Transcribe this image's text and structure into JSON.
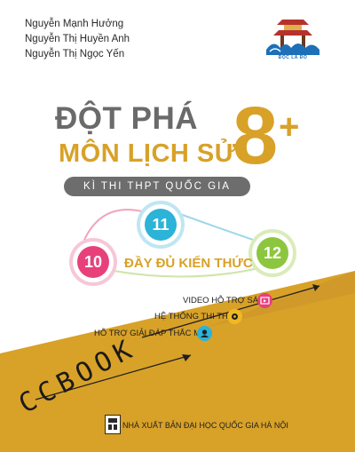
{
  "authors": [
    "Nguyễn Mạnh Hưởng",
    "Nguyễn Thị Huyền Anh",
    "Nguyễn Thị Ngọc Yến"
  ],
  "logo": {
    "text": "ĐỌC LÀ ĐỖ",
    "icon": "pagoda-wave-logo"
  },
  "title": {
    "line1": "ĐỘT PHÁ",
    "line2": "MÔN LỊCH SỬ",
    "grade": "8",
    "plus": "+"
  },
  "subtitle": "KÌ THI THPT QUỐC GIA",
  "grades": {
    "g10": "10",
    "g11": "11",
    "g12": "12"
  },
  "knowledge": "ĐẦY ĐỦ KIẾN THỨC",
  "features": [
    {
      "label": "VIDEO HỖ TRỢ SÁCH",
      "icon": "video-icon"
    },
    {
      "label": "HỆ THỐNG THI THỬ",
      "icon": "exam-icon"
    },
    {
      "label": "HỖ TRỢ GIẢI ĐÁP THẮC MẮC",
      "icon": "support-icon"
    }
  ],
  "brand": "CCBOOK",
  "publisher": "NHÀ XUẤT BẢN ĐẠI HỌC QUỐC GIA HÀ NỘI",
  "colors": {
    "gold": "#d8a128",
    "grey": "#6a6a6a",
    "pink": "#e8407a",
    "teal": "#2bb3d8",
    "green": "#8cc63f"
  }
}
